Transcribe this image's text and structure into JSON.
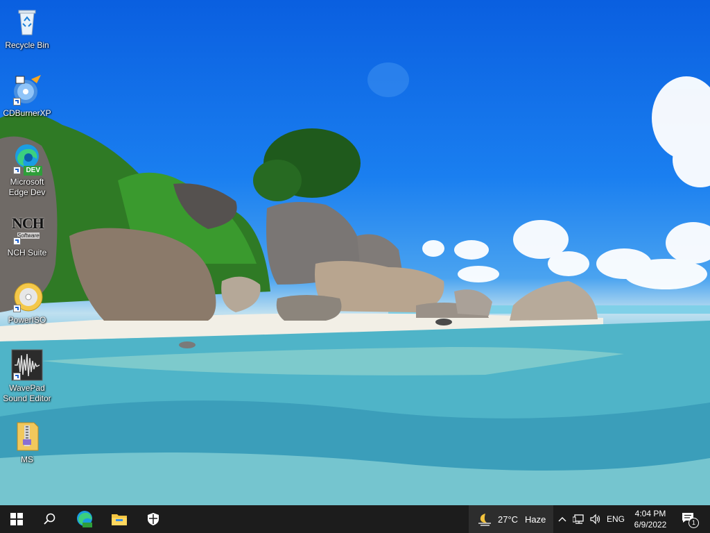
{
  "desktop": {
    "icons": [
      {
        "label": "Recycle Bin",
        "icon": "recycle-bin-icon"
      },
      {
        "label": "CDBurnerXP",
        "icon": "cdburnerxp-icon"
      },
      {
        "label": "Microsoft Edge Dev",
        "icon": "edge-dev-icon",
        "badge": "DEV"
      },
      {
        "label": "NCH Suite",
        "icon": "nch-suite-icon",
        "logo_text": "NCH",
        "logo_sub": "Software"
      },
      {
        "label": "PowerISO",
        "icon": "poweriso-icon"
      },
      {
        "label": "WavePad Sound Editor",
        "icon": "wavepad-icon"
      },
      {
        "label": "MS",
        "icon": "folder-zip-icon"
      }
    ]
  },
  "taskbar": {
    "start": {
      "icon": "windows-start-icon"
    },
    "search": {
      "icon": "search-icon"
    },
    "pinned": [
      {
        "name": "Microsoft Edge Dev",
        "icon": "edge-dev-icon",
        "badge": "DEV"
      },
      {
        "name": "File Explorer",
        "icon": "file-explorer-icon"
      },
      {
        "name": "Windows Security",
        "icon": "shield-icon"
      }
    ],
    "weather": {
      "temperature": "27°C",
      "condition": "Haze",
      "icon": "moon-haze-icon"
    },
    "tray": {
      "chevron": {
        "icon": "chevron-up-icon"
      },
      "network": {
        "icon": "network-icon"
      },
      "volume": {
        "icon": "speaker-icon"
      },
      "language": "ENG"
    },
    "clock": {
      "time": "4:04 PM",
      "date": "6/9/2022"
    },
    "notifications": {
      "icon": "action-center-icon",
      "count": "1"
    }
  },
  "colors": {
    "taskbar": "#1c1c1c",
    "weather_bg": "#2d2d2d",
    "sky": "#1a7ff0",
    "water": "#3aa4c4"
  }
}
